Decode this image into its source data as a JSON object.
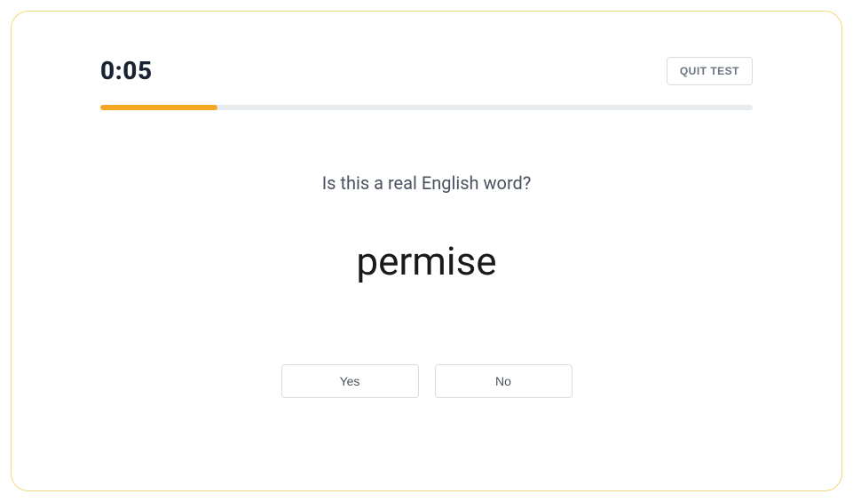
{
  "header": {
    "timer": "0:05",
    "quit_label": "QUIT TEST"
  },
  "progress": {
    "percent": 18
  },
  "question": {
    "prompt": "Is this a real English word?",
    "word": "permise"
  },
  "answers": {
    "yes_label": "Yes",
    "no_label": "No"
  }
}
